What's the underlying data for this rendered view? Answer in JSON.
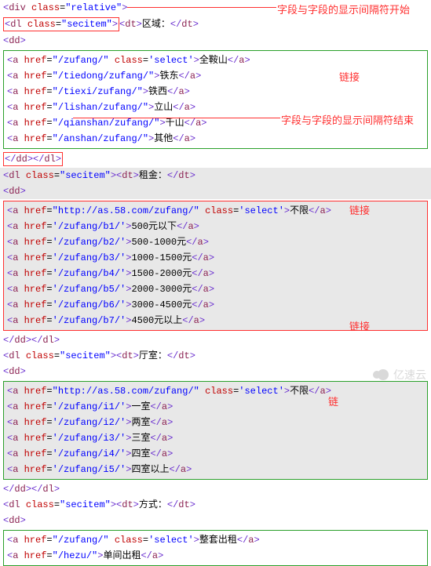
{
  "anno": {
    "sepStart": "字段与字段的显示间隔符开始",
    "sepEnd": "字段与字段的显示间隔符结束",
    "link1": "链接",
    "link2": "链接",
    "link3": "链接",
    "link4": "链",
    "watermark": "亿速云"
  },
  "top": {
    "divOpen": {
      "tag": "div",
      "attr": "class",
      "val": "\"relative\""
    },
    "dlOpen": {
      "tag": "dl",
      "attr": "class",
      "val": "\"secitem\""
    },
    "dtOpen": "dt",
    "dtText": "区域：",
    "dtClose": "dt",
    "ddOpen": "dd"
  },
  "block1": [
    {
      "href": "\"/zufang/\"",
      "extraAttr": "class",
      "extraVal": "'select'",
      "text": "全鞍山"
    },
    {
      "href": "\"/tiedong/zufang/\"",
      "text": "铁东"
    },
    {
      "href": "\"/tiexi/zufang/\"",
      "text": "铁西"
    },
    {
      "href": "\"/lishan/zufang/\"",
      "text": "立山"
    },
    {
      "href": "\"/qianshan/zufang/\"",
      "text": "千山"
    },
    {
      "href": "\"/anshan/zufang/\"",
      "text": "其他"
    }
  ],
  "close1": {
    "dd": "dd",
    "dl": "dl"
  },
  "sec2head": {
    "dlOpen": {
      "tag": "dl",
      "attr": "class",
      "val": "\"secitem\""
    },
    "dtOpen": "dt",
    "dtText": "租金：",
    "dtClose": "dt",
    "ddOpen": "dd"
  },
  "block2": [
    {
      "href": "\"http://as.58.com/zufang/\"",
      "extraAttr": "class",
      "extraVal": "'select'",
      "text": "不限"
    },
    {
      "href": "'/zufang/b1/'",
      "text": "500元以下"
    },
    {
      "href": "'/zufang/b2/'",
      "text": "500-1000元"
    },
    {
      "href": "'/zufang/b3/'",
      "text": "1000-1500元"
    },
    {
      "href": "'/zufang/b4/'",
      "text": "1500-2000元"
    },
    {
      "href": "'/zufang/b5/'",
      "text": "2000-3000元"
    },
    {
      "href": "'/zufang/b6/'",
      "text": "3000-4500元"
    },
    {
      "href": "'/zufang/b7/'",
      "text": "4500元以上"
    }
  ],
  "close2": {
    "dd": "dd",
    "dl": "dl"
  },
  "sec3head": {
    "dlOpen": {
      "tag": "dl",
      "attr": "class",
      "val": "\"secitem\""
    },
    "dtOpen": "dt",
    "dtText": "厅室：",
    "dtClose": "dt",
    "ddOpen": "dd"
  },
  "block3": [
    {
      "href": "\"http://as.58.com/zufang/\"",
      "extraAttr": "class",
      "extraVal": "'select'",
      "text": "不限"
    },
    {
      "href": "'/zufang/i1/'",
      "text": "一室"
    },
    {
      "href": "'/zufang/i2/'",
      "text": "两室"
    },
    {
      "href": "'/zufang/i3/'",
      "text": "三室"
    },
    {
      "href": "'/zufang/i4/'",
      "text": "四室"
    },
    {
      "href": "'/zufang/i5/'",
      "text": "四室以上"
    }
  ],
  "close3": {
    "dd": "dd",
    "dl": "dl"
  },
  "sec4head": {
    "dlOpen": {
      "tag": "dl",
      "attr": "class",
      "val": "\"secitem\""
    },
    "dtOpen": "dt",
    "dtText": "方式：",
    "dtClose": "dt",
    "ddOpen": "dd"
  },
  "block4": [
    {
      "href": "\"/zufang/\"",
      "extraAttr": "class",
      "extraVal": "'select'",
      "text": "整套出租"
    },
    {
      "href": "\"/hezu/\"",
      "text": "单间出租"
    }
  ]
}
